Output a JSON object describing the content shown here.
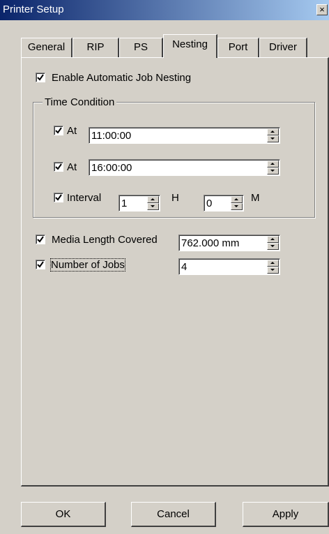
{
  "window": {
    "title": "Printer Setup",
    "close_glyph": "×"
  },
  "tabs": [
    {
      "label": "General",
      "active": false
    },
    {
      "label": "RIP",
      "active": false
    },
    {
      "label": "PS",
      "active": false
    },
    {
      "label": "Nesting",
      "active": true
    },
    {
      "label": "Port",
      "active": false
    },
    {
      "label": "Driver",
      "active": false
    }
  ],
  "nesting": {
    "enable_label": "Enable Automatic Job Nesting",
    "enable_checked": true,
    "time_condition": {
      "title": "Time Condition",
      "at1": {
        "label": "At",
        "checked": true,
        "value": "11:00:00"
      },
      "at2": {
        "label": "At",
        "checked": true,
        "value": "16:00:00"
      },
      "interval": {
        "label": "Interval",
        "checked": true,
        "hours_value": "1",
        "hours_unit": "H",
        "minutes_value": "0",
        "minutes_unit": "M"
      }
    },
    "media_length": {
      "label": "Media Length Covered",
      "checked": true,
      "value": "762.000 mm"
    },
    "number_of_jobs": {
      "label": "Number of Jobs",
      "checked": true,
      "value": "4"
    }
  },
  "buttons": {
    "ok": "OK",
    "cancel": "Cancel",
    "apply": "Apply"
  }
}
